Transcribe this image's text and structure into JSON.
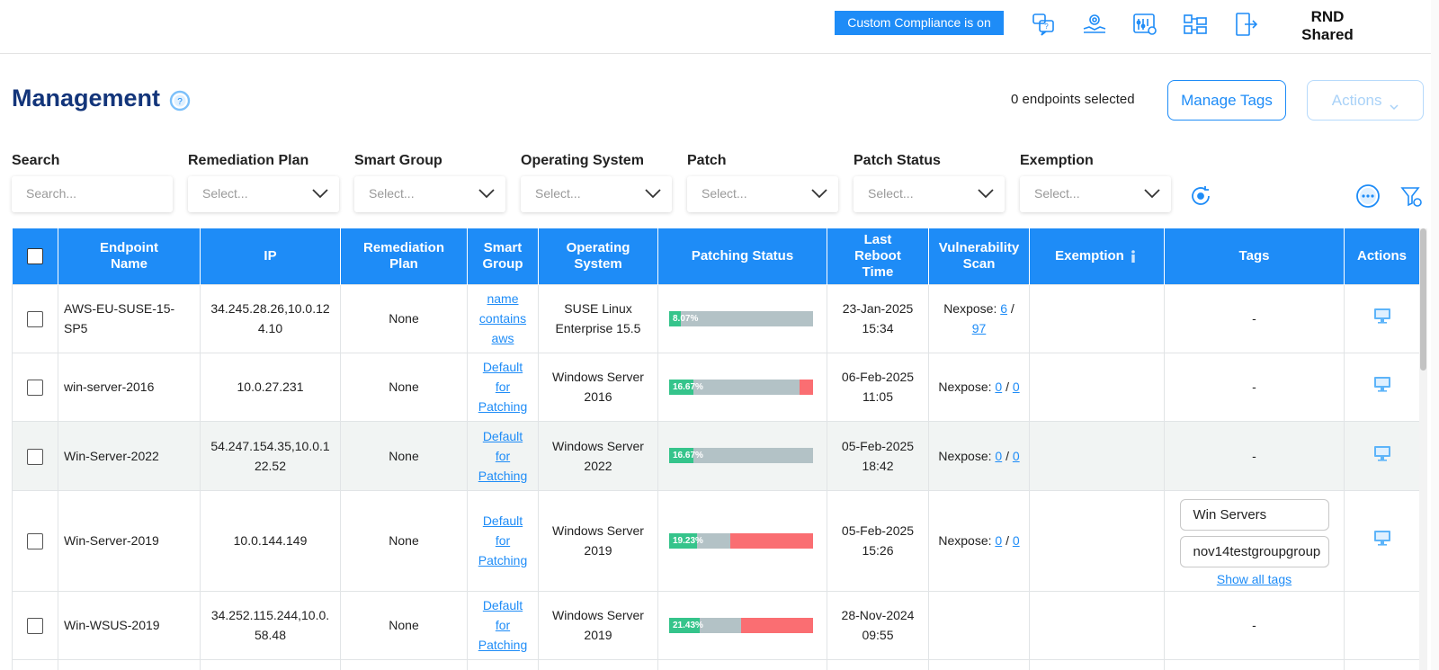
{
  "topbar": {
    "compliance_badge": "Custom Compliance is on",
    "icons": [
      "feedback-icon",
      "support-icon",
      "settings-sliders-icon",
      "network-icon",
      "logout-icon"
    ],
    "org_line1": "RND",
    "org_line2": "Shared"
  },
  "header": {
    "title": "Management",
    "selected_count": "0 endpoints selected",
    "manage_tags_label": "Manage Tags",
    "actions_label": "Actions"
  },
  "filters": [
    {
      "label": "Search",
      "placeholder": "Search..."
    },
    {
      "label": "Remediation Plan",
      "placeholder": "Select..."
    },
    {
      "label": "Smart Group",
      "placeholder": "Select..."
    },
    {
      "label": "Operating System",
      "placeholder": "Select..."
    },
    {
      "label": "Patch",
      "placeholder": "Select..."
    },
    {
      "label": "Patch Status",
      "placeholder": "Select..."
    },
    {
      "label": "Exemption",
      "placeholder": "Select..."
    }
  ],
  "table": {
    "columns": [
      "Endpoint Name",
      "IP",
      "Remediation Plan",
      "Smart Group",
      "Operating System",
      "Patching Status",
      "Last Reboot Time",
      "Vulnerability Scan",
      "Exemption",
      "Tags",
      "Actions"
    ],
    "column_lines": {
      "endpoint": [
        "Endpoint",
        "Name"
      ],
      "remediation": [
        "Remediation",
        "Plan"
      ],
      "smart": [
        "Smart",
        "Group"
      ],
      "os": [
        "Operating",
        "System"
      ],
      "reboot": [
        "Last",
        "Reboot",
        "Time"
      ],
      "vuln": [
        "Vulnerability",
        "Scan"
      ]
    },
    "rows": [
      {
        "name": "AWS-EU-SUSE-15-SP5",
        "ip": [
          "34.245.28.26,10.0.12",
          "4.10"
        ],
        "plan": "None",
        "smart_group": [
          "name",
          "contains",
          "aws"
        ],
        "os": [
          "SUSE Linux",
          "Enterprise 15.5"
        ],
        "patch_pct": "8.07%",
        "patch": {
          "green": 0.0807,
          "gray": 0.9193,
          "red": 0
        },
        "reboot": [
          "23-Jan-2025",
          "15:34"
        ],
        "vuln_prefix": "Nexpose:",
        "vuln_a": "6",
        "vuln_b": "97",
        "tags": "-"
      },
      {
        "name": "win-server-2016",
        "ip": [
          "10.0.27.231"
        ],
        "plan": "None",
        "smart_group": [
          "Default",
          "for",
          "Patching"
        ],
        "os": [
          "Windows Server",
          "2016"
        ],
        "patch_pct": "16.67%",
        "patch": {
          "green": 0.1667,
          "gray": 0.74,
          "red": 0.0933
        },
        "reboot": [
          "06-Feb-2025",
          "11:05"
        ],
        "vuln_prefix": "Nexpose:",
        "vuln_a": "0",
        "vuln_b": "0",
        "tags": "-"
      },
      {
        "name": "Win-Server-2022",
        "ip": [
          "54.247.154.35,10.0.1",
          "22.52"
        ],
        "plan": "None",
        "smart_group": [
          "Default",
          "for",
          "Patching"
        ],
        "os": [
          "Windows Server",
          "2022"
        ],
        "patch_pct": "16.67%",
        "patch": {
          "green": 0.1667,
          "gray": 0.8333,
          "red": 0
        },
        "reboot": [
          "05-Feb-2025",
          "18:42"
        ],
        "vuln_prefix": "Nexpose:",
        "vuln_a": "0",
        "vuln_b": "0",
        "tags": "-"
      },
      {
        "name": "Win-Server-2019",
        "ip": [
          "10.0.144.149"
        ],
        "plan": "None",
        "smart_group": [
          "Default",
          "for",
          "Patching"
        ],
        "os": [
          "Windows Server",
          "2019"
        ],
        "patch_pct": "19.23%",
        "patch": {
          "green": 0.1923,
          "gray": 0.2308,
          "red": 0.5769
        },
        "reboot": [
          "05-Feb-2025",
          "15:26"
        ],
        "vuln_prefix": "Nexpose:",
        "vuln_a": "0",
        "vuln_b": "0",
        "tag_chips": [
          "Win Servers",
          "nov14testgroupgroup"
        ],
        "show_all_tags": "Show all tags"
      },
      {
        "name": "Win-WSUS-2019",
        "ip": [
          "34.252.115.244,10.0.",
          "58.48"
        ],
        "plan": "None",
        "smart_group": [
          "Default",
          "for",
          "Patching"
        ],
        "os": [
          "Windows Server",
          "2019"
        ],
        "patch_pct": "21.43%",
        "patch": {
          "green": 0.2143,
          "gray": 0.2857,
          "red": 0.5
        },
        "reboot": [
          "28-Nov-2024",
          "09:55"
        ],
        "tags": "-"
      }
    ]
  },
  "colors": {
    "accent": "#1e8cf7",
    "title": "#13357a",
    "patched": "#35c48b",
    "pending": "#b3c2c6",
    "failed": "#fa6e72"
  }
}
